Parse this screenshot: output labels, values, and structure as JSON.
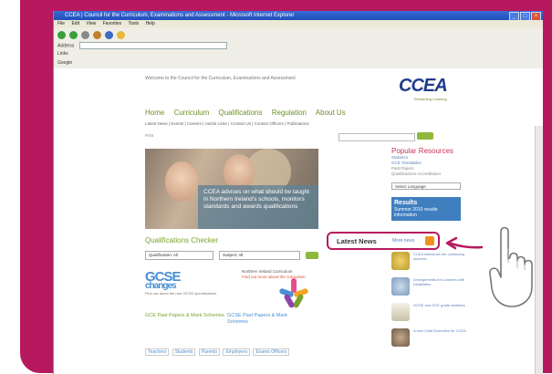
{
  "browser": {
    "title": "CCEA | Council for the Curriculum, Examinations and Assessment - Microsoft Internet Explorer",
    "menu": [
      "File",
      "Edit",
      "View",
      "Favorites",
      "Tools",
      "Help"
    ],
    "address_label": "Address",
    "address_value": "http://www.ccea.org.uk/",
    "links_label": "Links",
    "google_label": "Google"
  },
  "site": {
    "crumb": "Welcome to the Council for the Curriculum, Examinations and Assessment",
    "logo": "CCEA",
    "logo_sub": "Rewarding Learning",
    "nav": [
      "Home",
      "Curriculum",
      "Qualifications",
      "Regulation",
      "About Us"
    ],
    "subnav": "Latest News | Events | Careers | Useful Links | Contact Us | Contact Officers | Publications",
    "print": "Print",
    "hero_text": "CCEA advises on what should be taught in Northern Ireland's schools, monitors standards and awards qualifications"
  },
  "checker": {
    "title": "Qualifications Checker",
    "select1": "Qualification: All",
    "select2": "Subject: All"
  },
  "promos": {
    "gcse_big": "GCSE",
    "gcse_sub": "changes",
    "gcse_text": "Find out about the new GCSE specifications",
    "curriculum": "Northern Ireland Curriculum",
    "curriculum_red": "Find out more about the curriculum",
    "past_papers_left": "GCE Past Papers & Mark Schemes",
    "past_papers_right": "GCSE Past Papers & Mark Schemes",
    "tabs": [
      "Teachers",
      "Students",
      "Parents",
      "Employers",
      "Exams Officers"
    ]
  },
  "sidebar": {
    "title": "Popular Resources",
    "links": [
      "Statistics",
      "GCE Timetables",
      "Past Papers",
      "Qualifications Accreditation"
    ],
    "lang": "Select Language",
    "blue_title": "Results",
    "blue_text": "Summer 2010 results information"
  },
  "news": {
    "title": "Latest News",
    "more": "More news",
    "items": [
      "CCEA welcomes the continuing success",
      "Arrangements for Learners with Disabilities",
      "GCSE and GCE grade statistics",
      "A new Chief Executive for CCEA"
    ]
  },
  "colors": {
    "frame": "#b7195e",
    "accent_green": "#7ca22e",
    "link_blue": "#5a7fb5"
  },
  "icons": [
    "back-icon",
    "forward-icon",
    "refresh-icon",
    "home-icon",
    "search-icon",
    "favorites-icon",
    "rss-icon",
    "pointing-hand-icon",
    "arrow-icon"
  ]
}
